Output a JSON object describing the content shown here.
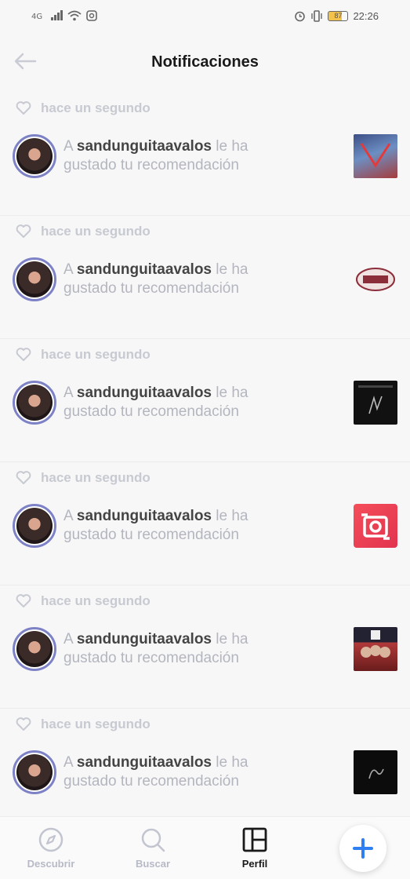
{
  "status_bar": {
    "time": "22:26",
    "battery": "87"
  },
  "header": {
    "title": "Notificaciones"
  },
  "notifications": [
    {
      "time": "hace un segundo",
      "prefix": "A",
      "user": "sandunguitaavalos",
      "text": "le ha gustado tu recomendación",
      "thumb_icon": "album-cover"
    },
    {
      "time": "hace un segundo",
      "prefix": "A",
      "user": "sandunguitaavalos",
      "text": "le ha gustado tu recomendación",
      "thumb_icon": "album-cover"
    },
    {
      "time": "hace un segundo",
      "prefix": "A",
      "user": "sandunguitaavalos",
      "text": "le ha gustado tu recomendación",
      "thumb_icon": "album-cover"
    },
    {
      "time": "hace un segundo",
      "prefix": "A",
      "user": "sandunguitaavalos",
      "text": "le ha gustado tu recomendación",
      "thumb_icon": "app-icon"
    },
    {
      "time": "hace un segundo",
      "prefix": "A",
      "user": "sandunguitaavalos",
      "text": "le ha gustado tu recomendación",
      "thumb_icon": "album-cover"
    },
    {
      "time": "hace un segundo",
      "prefix": "A",
      "user": "sandunguitaavalos",
      "text": "le ha gustado tu recomendación",
      "thumb_icon": "album-cover"
    }
  ],
  "bottom_nav": {
    "items": [
      {
        "label": "Descubrir",
        "icon": "compass-icon",
        "active": false
      },
      {
        "label": "Buscar",
        "icon": "search-icon",
        "active": false
      },
      {
        "label": "Perfil",
        "icon": "profile-grid-icon",
        "active": true
      }
    ],
    "fab_icon": "plus-icon"
  },
  "colors": {
    "accent": "#2f7ff3",
    "avatar_ring": "#7d82c6",
    "muted_text": "#b4b6bf"
  }
}
